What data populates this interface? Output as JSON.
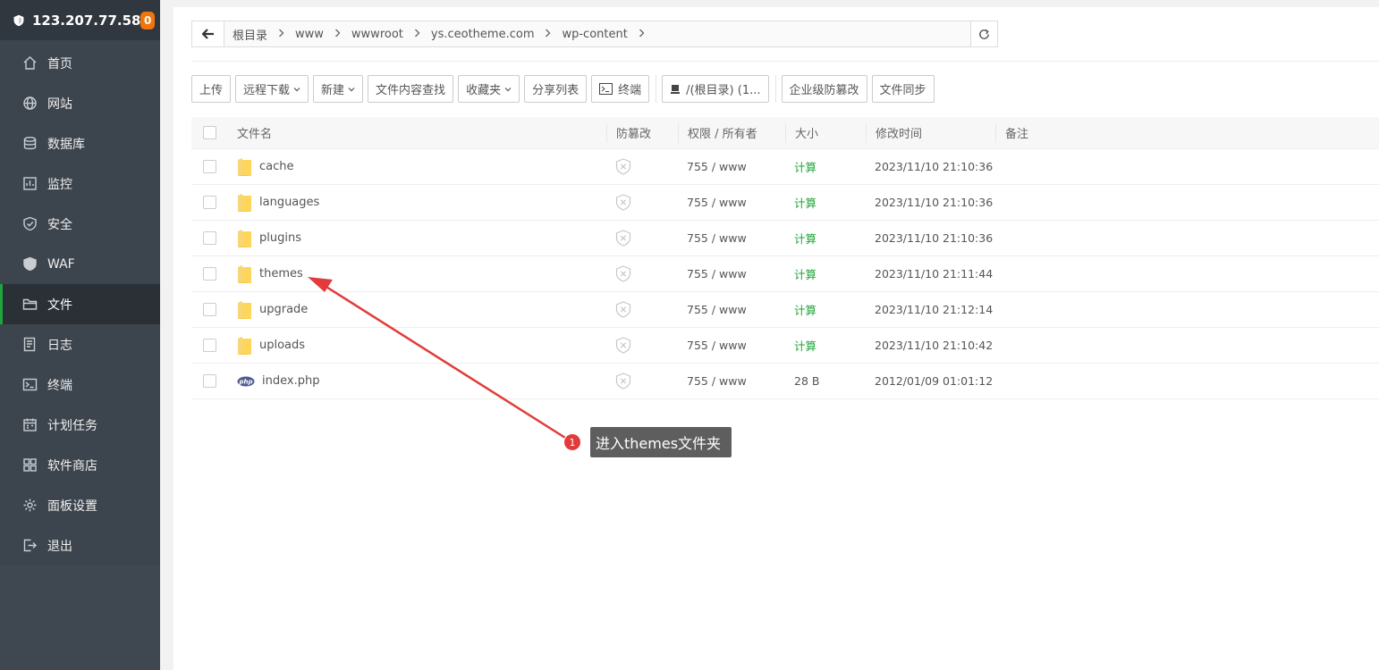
{
  "header": {
    "ip": "123.207.77.58",
    "badge": "0"
  },
  "nav": [
    {
      "label": "首页",
      "icon": "home-icon"
    },
    {
      "label": "网站",
      "icon": "globe-icon"
    },
    {
      "label": "数据库",
      "icon": "database-icon"
    },
    {
      "label": "监控",
      "icon": "monitor-icon"
    },
    {
      "label": "安全",
      "icon": "shield-icon"
    },
    {
      "label": "WAF",
      "icon": "waf-icon"
    },
    {
      "label": "文件",
      "icon": "folder-icon",
      "active": true
    },
    {
      "label": "日志",
      "icon": "log-icon"
    },
    {
      "label": "终端",
      "icon": "terminal-icon"
    },
    {
      "label": "计划任务",
      "icon": "calendar-icon"
    },
    {
      "label": "软件商店",
      "icon": "apps-icon"
    },
    {
      "label": "面板设置",
      "icon": "gear-icon"
    },
    {
      "label": "退出",
      "icon": "logout-icon"
    }
  ],
  "path": {
    "crumbs": [
      "根目录",
      "www",
      "wwwroot",
      "ys.ceotheme.com",
      "wp-content"
    ]
  },
  "toolbar": {
    "upload": "上传",
    "remote_download": "远程下载",
    "new": "新建",
    "content_search": "文件内容查找",
    "favorites": "收藏夹",
    "share_list": "分享列表",
    "terminal": "终端",
    "disk": "/(根目录) (1...",
    "tamper": "企业级防篡改",
    "sync": "文件同步"
  },
  "table": {
    "headers": {
      "name": "文件名",
      "guard": "防篡改",
      "perm": "权限 / 所有者",
      "size": "大小",
      "mtime": "修改时间",
      "note": "备注"
    },
    "rows": [
      {
        "name": "cache",
        "type": "folder",
        "perm": "755 / www",
        "size": "计算",
        "mtime": "2023/11/10 21:10:36"
      },
      {
        "name": "languages",
        "type": "folder",
        "perm": "755 / www",
        "size": "计算",
        "mtime": "2023/11/10 21:10:36"
      },
      {
        "name": "plugins",
        "type": "folder",
        "perm": "755 / www",
        "size": "计算",
        "mtime": "2023/11/10 21:10:36"
      },
      {
        "name": "themes",
        "type": "folder",
        "perm": "755 / www",
        "size": "计算",
        "mtime": "2023/11/10 21:11:44"
      },
      {
        "name": "upgrade",
        "type": "folder",
        "perm": "755 / www",
        "size": "计算",
        "mtime": "2023/11/10 21:12:14"
      },
      {
        "name": "uploads",
        "type": "folder",
        "perm": "755 / www",
        "size": "计算",
        "mtime": "2023/11/10 21:10:42"
      },
      {
        "name": "index.php",
        "type": "php",
        "perm": "755 / www",
        "size": "28 B",
        "mtime": "2012/01/09 01:01:12"
      }
    ]
  },
  "annotation": {
    "number": "1",
    "text": "进入themes文件夹"
  },
  "colors": {
    "accent": "#20a53a",
    "sidebar": "#3c444d",
    "badge": "#f0760c",
    "annotation_red": "#e23b3b"
  }
}
